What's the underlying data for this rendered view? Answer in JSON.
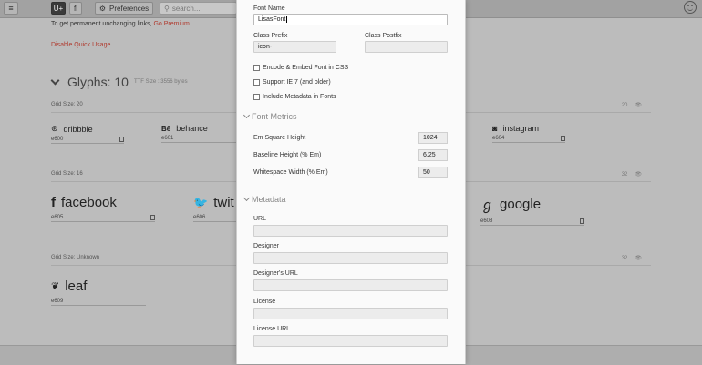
{
  "toolbar": {
    "menu_icon": "hamburger-icon",
    "unicode_toggle": "U+",
    "ligature_toggle": "fi",
    "preferences_label": "Preferences",
    "search_placeholder": "search..."
  },
  "background": {
    "notice_text": "To get permanent unchanging links,",
    "notice_link": "Go Premium.",
    "quick_usage_link": "Disable Quick Usage",
    "glyphs_title": "Glyphs: 10",
    "ttf_size": "TTF Size : 3556 bytes",
    "groups": [
      {
        "grid_label": "Grid Size: 20",
        "grid_value": "20",
        "glyphs": [
          {
            "name": "dribbble",
            "code": "e600",
            "icon": "dribbble-icon"
          },
          {
            "name": "behance",
            "code": "e601",
            "icon": "behance-icon"
          },
          {
            "name": "instagram",
            "code": "e604",
            "icon": "instagram-icon"
          }
        ]
      },
      {
        "grid_label": "Grid Size: 16",
        "grid_value": "32",
        "glyphs": [
          {
            "name": "facebook",
            "code": "e605",
            "icon": "facebook-icon"
          },
          {
            "name": "twit",
            "code": "e606",
            "icon": "twitter-icon"
          },
          {
            "name": "google",
            "code": "e608",
            "icon": "google-icon"
          }
        ]
      },
      {
        "grid_label": "Grid Size: Unknown",
        "grid_value": "32",
        "glyphs": [
          {
            "name": "leaf",
            "code": "e609",
            "icon": "leaf-icon"
          }
        ]
      }
    ]
  },
  "panel": {
    "font_name_label": "Font Name",
    "font_name_value": "LisasFont",
    "class_prefix_label": "Class Prefix",
    "class_prefix_value": "icon-",
    "class_postfix_label": "Class Postfix",
    "class_postfix_value": "",
    "checkboxes": [
      {
        "label": "Encode & Embed Font in CSS",
        "checked": false
      },
      {
        "label": "Support IE 7 (and older)",
        "checked": false
      },
      {
        "label": "Include Metadata in Fonts",
        "checked": false
      }
    ],
    "font_metrics_title": "Font Metrics",
    "metrics": [
      {
        "label": "Em Square Height",
        "value": "1024"
      },
      {
        "label": "Baseline Height (% Em)",
        "value": "6.25"
      },
      {
        "label": "Whitespace Width (% Em)",
        "value": "50"
      }
    ],
    "metadata_title": "Metadata",
    "metadata_fields": [
      {
        "label": "URL",
        "value": ""
      },
      {
        "label": "Designer",
        "value": ""
      },
      {
        "label": "Designer's URL",
        "value": ""
      },
      {
        "label": "License",
        "value": ""
      },
      {
        "label": "License URL",
        "value": ""
      }
    ]
  }
}
